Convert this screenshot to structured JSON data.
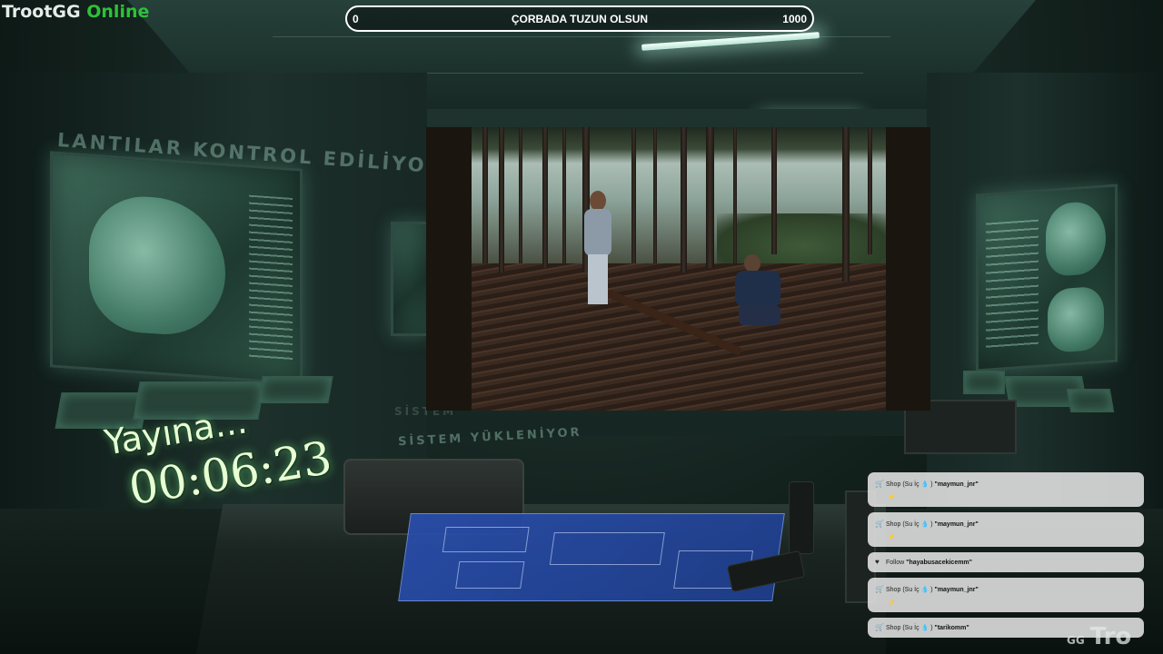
{
  "brand": {
    "name": "TrootGG",
    "suffix": "Online",
    "name_color": "#e6ece9",
    "suffix_color": "#2fc03a"
  },
  "goal_bar": {
    "min": "0",
    "title": "ÇORBADA TUZUN OLSUN",
    "max": "1000",
    "progress": 0
  },
  "wall_texts": {
    "top": "LANTILAR KONTROL EDİLİYOR",
    "lower_1": "SİSTEM",
    "lower_2": "SİSTEM YÜKLENİYOR"
  },
  "countdown": {
    "label": "Yayına...",
    "time": "00:06:23"
  },
  "event_feed": [
    {
      "icon": "cart-icon",
      "type": "Shop",
      "item": "(Su İç 💧 )",
      "user": "\"maymun_jnr\"",
      "sub": "⚡"
    },
    {
      "icon": "cart-icon",
      "type": "Shop",
      "item": "(Su İç 💧 )",
      "user": "\"maymun_jnr\"",
      "sub": "⚡"
    },
    {
      "icon": "heart-icon",
      "type": "Follow",
      "item": "",
      "user": "\"hayabusacekicemm\"",
      "sub": ""
    },
    {
      "icon": "cart-icon",
      "type": "Shop",
      "item": "(Su İç 💧 )",
      "user": "\"maymun_jnr\"",
      "sub": "⚡"
    },
    {
      "icon": "cart-icon",
      "type": "Shop",
      "item": "(Su İç 💧 )",
      "user": "\"tarikomm\"",
      "sub": ""
    }
  ],
  "footer_logo": {
    "small": "GG",
    "large": "Tro"
  }
}
